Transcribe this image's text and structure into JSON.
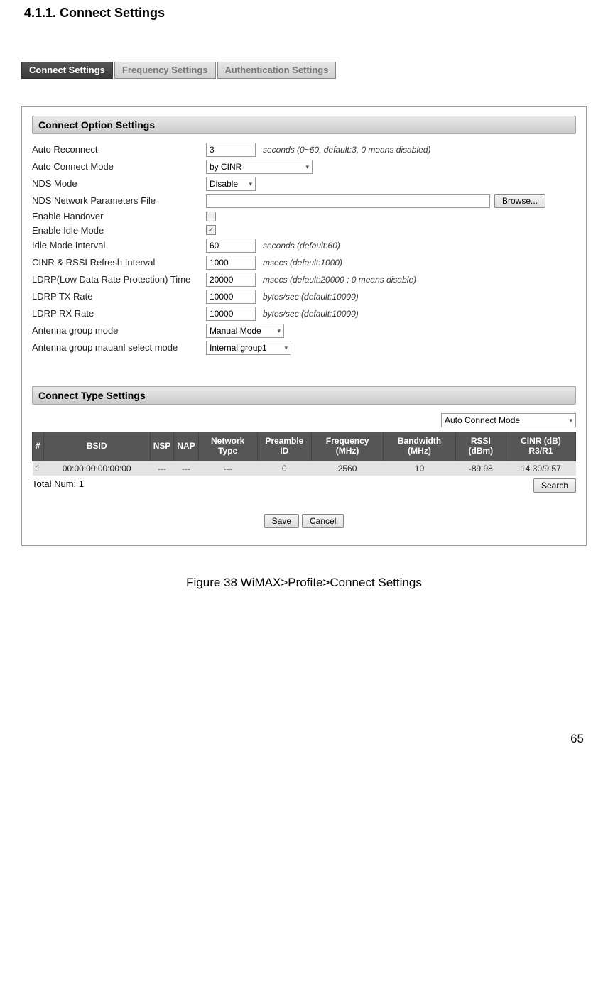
{
  "heading": "4.1.1.  Connect Settings",
  "tabs": {
    "connect": "Connect Settings",
    "frequency": "Frequency Settings",
    "auth": "Authentication Settings"
  },
  "sec1": "Connect Option Settings",
  "fields": {
    "auto_reconnect": {
      "label": "Auto Reconnect",
      "value": "3",
      "hint": "seconds (0~60, default:3, 0 means disabled)"
    },
    "auto_connect_mode": {
      "label": "Auto Connect Mode",
      "value": "by CINR"
    },
    "nds_mode": {
      "label": "NDS Mode",
      "value": "Disable"
    },
    "nds_file": {
      "label": "NDS Network Parameters File",
      "browse": "Browse..."
    },
    "handover": {
      "label": "Enable Handover",
      "checked": false
    },
    "idle": {
      "label": "Enable Idle Mode",
      "checked": true
    },
    "idle_interval": {
      "label": "Idle Mode Interval",
      "value": "60",
      "hint": "seconds (default:60)"
    },
    "refresh": {
      "label": "CINR & RSSI Refresh Interval",
      "value": "1000",
      "hint": "msecs (default:1000)"
    },
    "ldrp_time": {
      "label": "LDRP(Low Data Rate Protection) Time",
      "value": "20000",
      "hint": "msecs (default:20000 ; 0 means disable)"
    },
    "ldrp_tx": {
      "label": "LDRP TX Rate",
      "value": "10000",
      "hint": "bytes/sec (default:10000)"
    },
    "ldrp_rx": {
      "label": "LDRP RX Rate",
      "value": "10000",
      "hint": "bytes/sec (default:10000)"
    },
    "ant_mode": {
      "label": "Antenna group mode",
      "value": "Manual Mode"
    },
    "ant_sel": {
      "label": "Antenna group mauanl select mode",
      "value": "Internal group1"
    }
  },
  "sec2": "Connect Type Settings",
  "mode_select": "Auto Connect Mode",
  "table": {
    "headers": {
      "n": "#",
      "bsid": "BSID",
      "nsp": "NSP",
      "nap": "NAP",
      "nt": "Network Type",
      "pid": "Preamble ID",
      "freq": "Frequency (MHz)",
      "bw": "Bandwidth (MHz)",
      "rssi": "RSSI (dBm)",
      "cinr": "CINR (dB) R3/R1"
    },
    "row": {
      "n": "1",
      "bsid": "00:00:00:00:00:00",
      "nsp": "---",
      "nap": "---",
      "nt": "---",
      "pid": "0",
      "freq": "2560",
      "bw": "10",
      "rssi": "-89.98",
      "cinr": "14.30/9.57"
    }
  },
  "total": "Total Num: 1",
  "search": "Search",
  "save": "Save",
  "cancel": "Cancel",
  "caption": "Figure 38  WiMAX>ProfiIe>Connect Settings",
  "page": "65"
}
